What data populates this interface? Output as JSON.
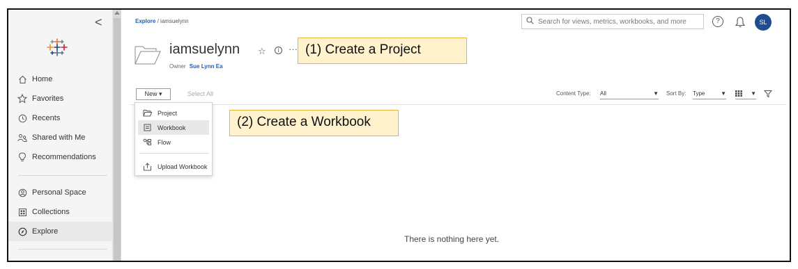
{
  "sidebar": {
    "collapse_glyph": "<",
    "items": [
      {
        "label": "Home",
        "icon": "home-icon"
      },
      {
        "label": "Favorites",
        "icon": "star-icon"
      },
      {
        "label": "Recents",
        "icon": "clock-icon"
      },
      {
        "label": "Shared with Me",
        "icon": "shared-users-icon"
      },
      {
        "label": "Recommendations",
        "icon": "lightbulb-icon"
      },
      {
        "label": "Personal Space",
        "icon": "person-circle-icon"
      },
      {
        "label": "Collections",
        "icon": "collections-icon"
      },
      {
        "label": "Explore",
        "icon": "compass-icon"
      }
    ]
  },
  "breadcrumb": {
    "root": "Explore",
    "separator": "/",
    "current": "iamsuelynn"
  },
  "search": {
    "placeholder": "Search for views, metrics, workbooks, and more"
  },
  "header": {
    "help_glyph": "?",
    "avatar_initials": "SL"
  },
  "project": {
    "title": "iamsuelynn",
    "owner_label": "Owner",
    "owner_name": "Sue Lynn Ea",
    "star_glyph": "☆",
    "info_glyph": "i",
    "more_glyph": "···"
  },
  "callouts": {
    "create_project": "(1) Create a Project",
    "create_workbook": "(2) Create a Workbook"
  },
  "toolbar": {
    "new_label": "New ▾",
    "select_all": "Select All",
    "content_type_label": "Content Type:",
    "content_type_value": "All",
    "sort_by_label": "Sort By:",
    "sort_by_value": "Type"
  },
  "new_menu": {
    "items": [
      {
        "label": "Project",
        "icon": "folder-icon"
      },
      {
        "label": "Workbook",
        "icon": "workbook-icon"
      },
      {
        "label": "Flow",
        "icon": "flow-icon"
      },
      {
        "label": "Upload Workbook",
        "icon": "upload-icon"
      }
    ]
  },
  "empty_state": "There is nothing here yet.",
  "colors": {
    "accent": "#1f5fb2",
    "avatar": "#1e4e91",
    "callout_bg": "#fff2cc",
    "callout_border": "#e6b33c"
  }
}
